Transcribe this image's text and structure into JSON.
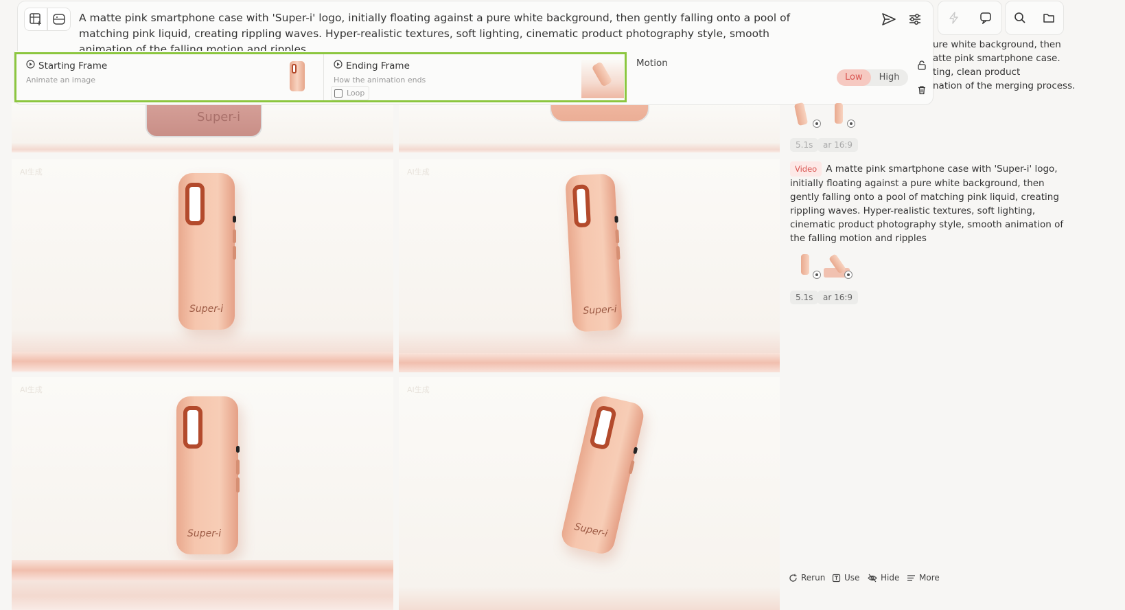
{
  "prompt": {
    "text": "A matte pink smartphone case with 'Super-i' logo, initially floating against a pure white background, then gently falling onto a pool of matching pink liquid, creating rippling waves. Hyper-realistic textures, soft lighting, cinematic product photography style, smooth animation of the falling motion and ripples"
  },
  "toolbar_icons": [
    "frames-add-icon",
    "image-gen-icon",
    "send-icon",
    "sliders-icon"
  ],
  "frames": {
    "start": {
      "title": "Starting Frame",
      "subtitle": "Animate an image"
    },
    "end": {
      "title": "Ending Frame",
      "subtitle": "How the animation ends",
      "loop_label": "Loop",
      "loop_checked": false
    }
  },
  "motion": {
    "label": "Motion",
    "options": [
      "Low",
      "High"
    ],
    "selected": "Low"
  },
  "right_panel": {
    "top_icons": [
      "bolt-icon",
      "chat-icon",
      "search-icon",
      "folder-icon"
    ],
    "prev_text_lines": [
      "ure white background, then",
      "atte pink smartphone case.",
      "ting, clean product",
      "nation of the merging process."
    ],
    "prev_chips": [
      "5.1s",
      "ar 16:9"
    ],
    "entry": {
      "badge": "Video",
      "text": "A matte pink smartphone case with 'Super-i' logo, initially floating against a pure white background, then gently falling onto a pool of matching pink liquid, creating rippling waves. Hyper-realistic textures, soft lighting, cinematic product photography style, smooth animation of the falling motion and ripples",
      "chips": [
        "5.1s",
        "ar 16:9"
      ]
    },
    "actions": [
      "Rerun",
      "Use",
      "Hide",
      "More"
    ]
  },
  "tiles": {
    "watermark": "AI生成",
    "logo_text": "Super-i"
  },
  "colors": {
    "highlight": "#8cc63f",
    "accent": "#d9534f",
    "phone": "#f6c6ae"
  }
}
